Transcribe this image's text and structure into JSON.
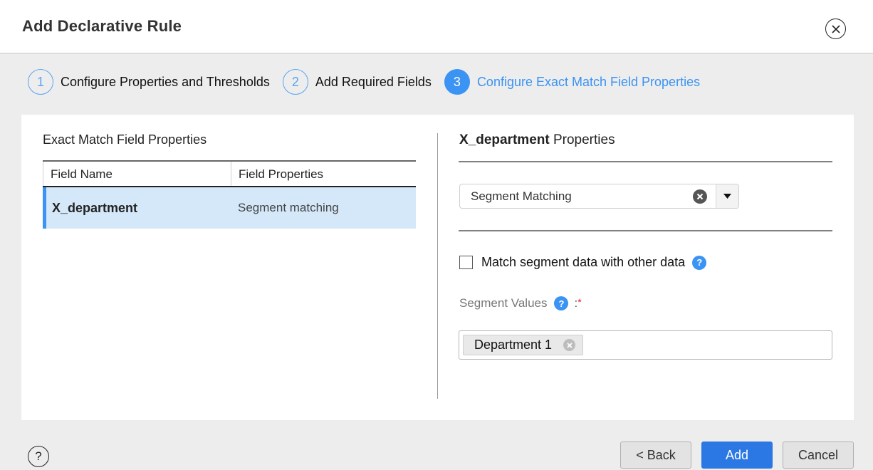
{
  "dialog": {
    "title": "Add Declarative Rule",
    "close_icon": "close-circle-icon"
  },
  "steps": [
    {
      "number": "1",
      "label": "Configure Properties and Thresholds",
      "state": "completed"
    },
    {
      "number": "2",
      "label": "Add Required Fields",
      "state": "completed"
    },
    {
      "number": "3",
      "label": "Configure Exact Match Field Properties",
      "state": "active"
    }
  ],
  "left_panel": {
    "title": "Exact Match Field Properties",
    "columns": [
      "Field Name",
      "Field Properties"
    ],
    "rows": [
      {
        "field_name": "X_department",
        "field_properties": "Segment matching",
        "selected": true
      }
    ]
  },
  "right_panel": {
    "field_name": "X_department",
    "title_suffix": "Properties",
    "property_type": {
      "selected": "Segment Matching",
      "clear_icon": "clear-circle-icon",
      "dropdown_icon": "caret-down-icon"
    },
    "match_other_data": {
      "label": "Match segment data with other data",
      "checked": false,
      "help_icon": "help-circle-icon"
    },
    "segment_values": {
      "label": "Segment Values",
      "colon": ":",
      "required_marker": "*",
      "tags": [
        "Department 1"
      ]
    }
  },
  "footer": {
    "help_icon": "help-outline-icon",
    "help_glyph": "?",
    "back_label": "< Back",
    "add_label": "Add",
    "cancel_label": "Cancel"
  },
  "colors": {
    "accent": "#3b93f3",
    "primary_button": "#2b78e4",
    "selected_row": "#d4e8f9",
    "required": "#e02020"
  }
}
